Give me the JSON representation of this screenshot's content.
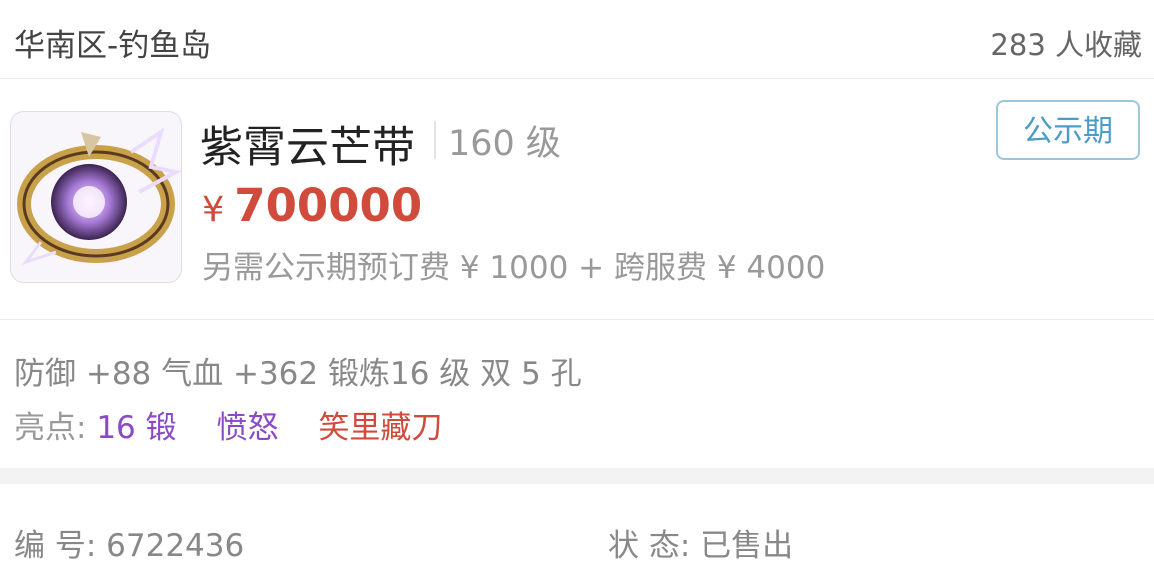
{
  "header": {
    "server": "华南区-钓鱼岛",
    "favorites": "283 人收藏"
  },
  "item": {
    "icon": "purple-belt-icon",
    "name": "紫霄云芒带",
    "level": "160 级",
    "status_badge": "公示期",
    "price_currency": "¥",
    "price": "700000",
    "extra_fees": "另需公示期预订费 ¥ 1000 + 跨服费 ¥ 4000"
  },
  "attributes": "防御 +88 气血 +362 锻炼16 级 双 5 孔",
  "highlights": {
    "label": "亮点:",
    "items": [
      "16 锻",
      "愤怒",
      "笑里藏刀"
    ]
  },
  "meta": {
    "id": "编 号:  6722436",
    "status": "状 态:  已售出"
  },
  "colors": {
    "price": "#d14b3d",
    "highlight_purple": "#8a49c6",
    "badge_blue": "#4b9dc8"
  }
}
